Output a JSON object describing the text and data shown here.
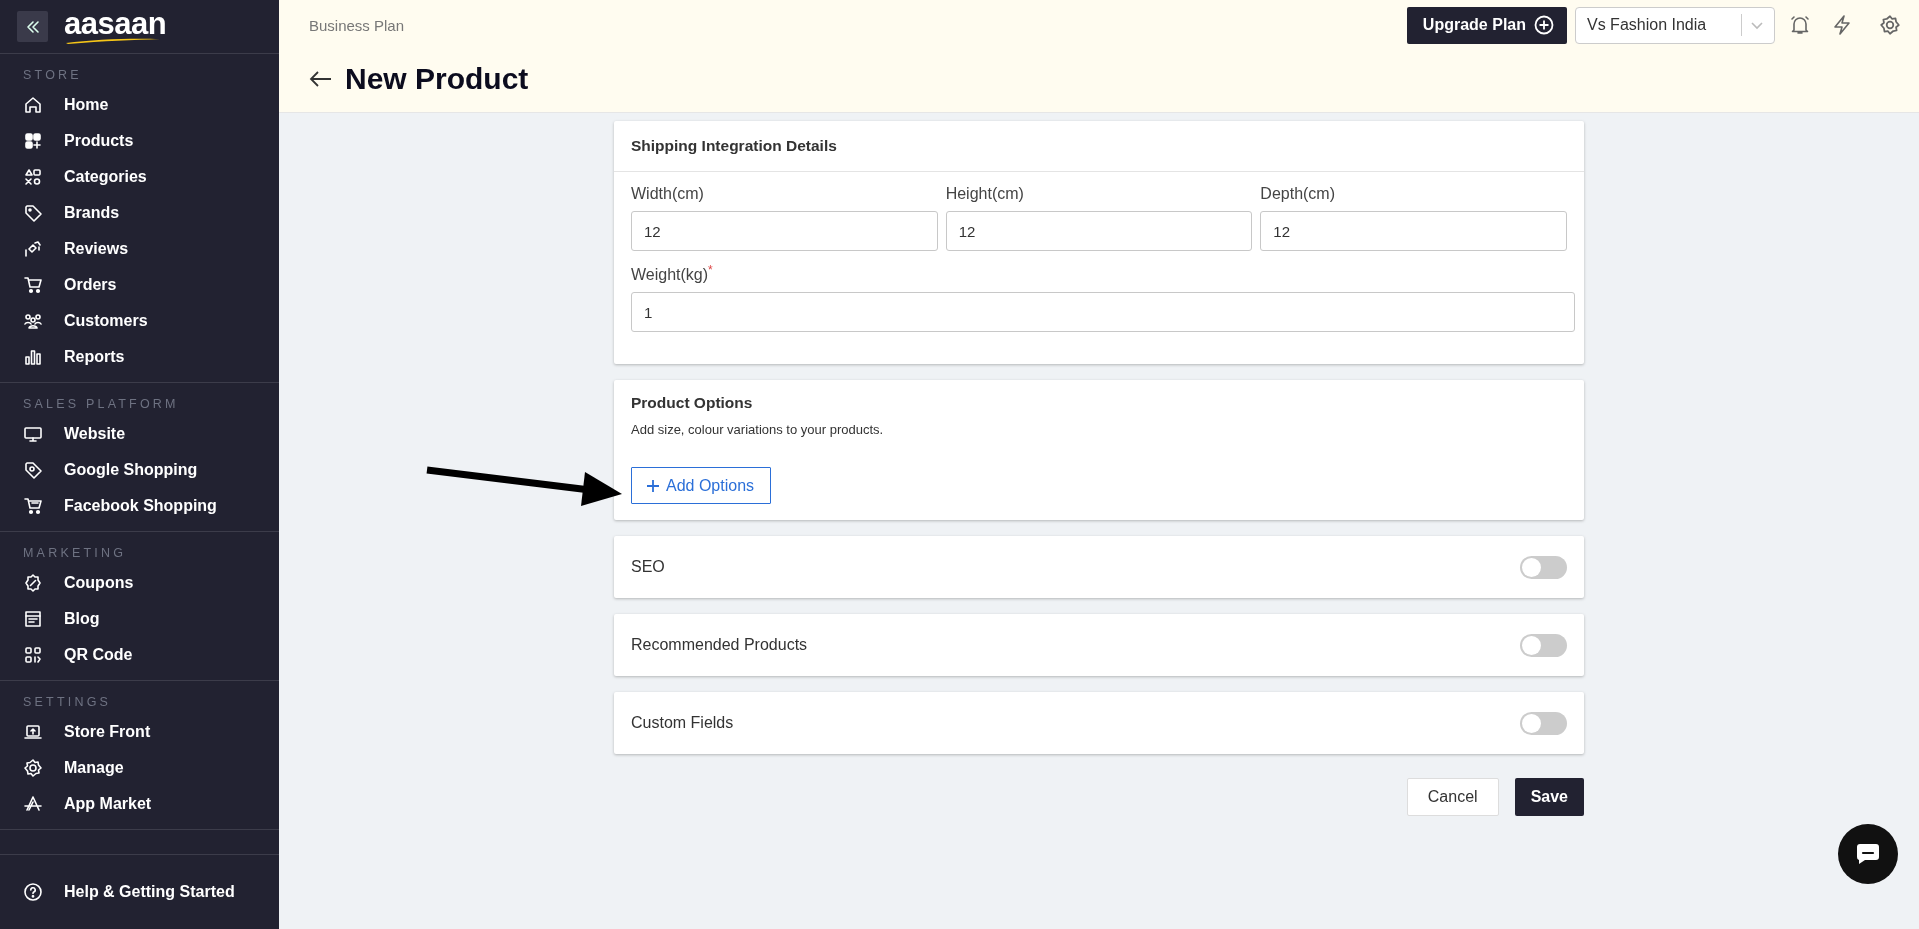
{
  "sidebar": {
    "logo": "aasaan",
    "sections": [
      {
        "title": "STORE",
        "items": [
          "Home",
          "Products",
          "Categories",
          "Brands",
          "Reviews",
          "Orders",
          "Customers",
          "Reports"
        ]
      },
      {
        "title": "SALES PLATFORM",
        "items": [
          "Website",
          "Google Shopping",
          "Facebook Shopping"
        ]
      },
      {
        "title": "MARKETING",
        "items": [
          "Coupons",
          "Blog",
          "QR Code"
        ]
      },
      {
        "title": "SETTINGS",
        "items": [
          "Store Front",
          "Manage",
          "App Market"
        ]
      }
    ],
    "footer_item": "Help & Getting Started"
  },
  "header": {
    "plan": "Business Plan",
    "title": "New Product",
    "upgrade_button": "Upgrade Plan",
    "store_select": "Vs Fashion India"
  },
  "shipping": {
    "title": "Shipping Integration Details",
    "fields": [
      {
        "label": "Width(cm)",
        "value": "12"
      },
      {
        "label": "Height(cm)",
        "value": "12"
      },
      {
        "label": "Depth(cm)",
        "value": "12"
      },
      {
        "label": "Weight(kg)",
        "required_mark": "*",
        "value": "1"
      }
    ]
  },
  "product_options": {
    "title": "Product Options",
    "description": "Add size, colour variations to your products.",
    "button": "Add Options"
  },
  "toggles": [
    {
      "label": "SEO",
      "on": false
    },
    {
      "label": "Recommended Products",
      "on": false
    },
    {
      "label": "Custom Fields",
      "on": false
    }
  ],
  "actions": {
    "cancel": "Cancel",
    "save": "Save"
  }
}
